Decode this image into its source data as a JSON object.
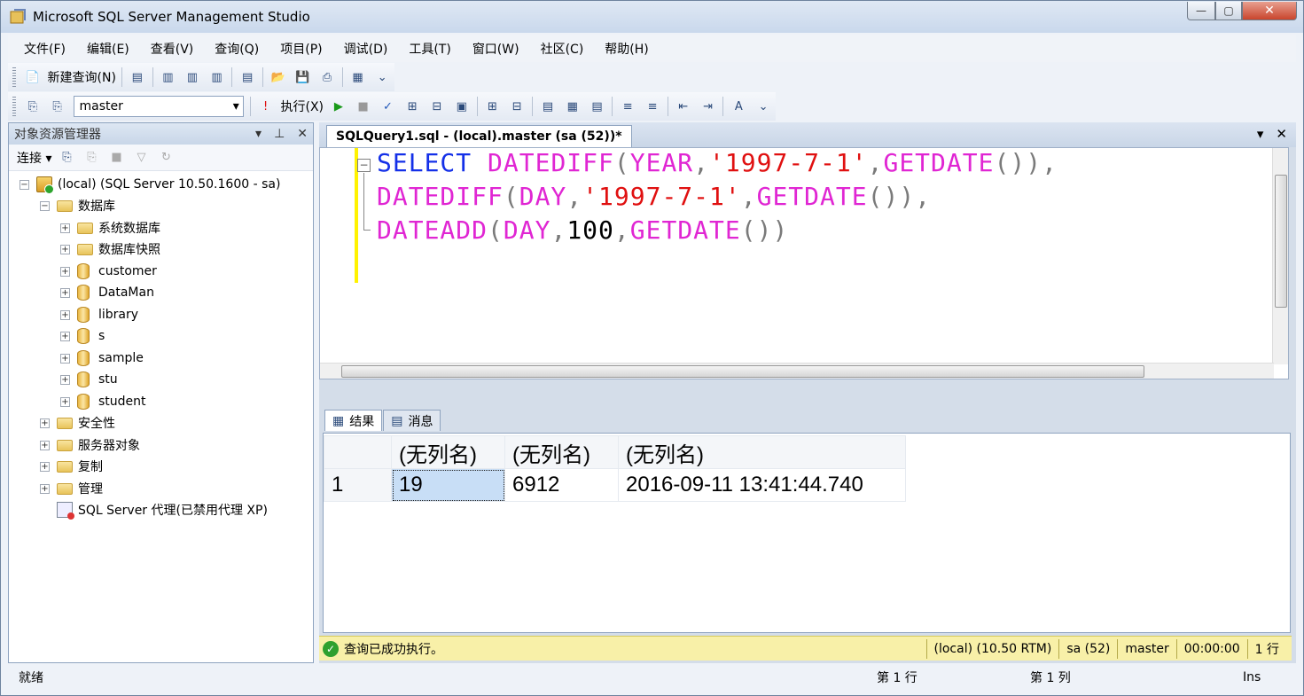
{
  "window": {
    "title": "Microsoft SQL Server Management Studio"
  },
  "menu": [
    "文件(F)",
    "编辑(E)",
    "查看(V)",
    "查询(Q)",
    "项目(P)",
    "调试(D)",
    "工具(T)",
    "窗口(W)",
    "社区(C)",
    "帮助(H)"
  ],
  "toolbar": {
    "new_query": "新建查询(N)",
    "database": "master",
    "execute": "执行(X)"
  },
  "object_explorer": {
    "title": "对象资源管理器",
    "connect": "连接",
    "server": "(local) (SQL Server 10.50.1600 - sa)",
    "databases_label": "数据库",
    "system_folders": [
      "系统数据库",
      "数据库快照"
    ],
    "databases": [
      "customer",
      "DataMan",
      "library",
      "s",
      "sample",
      "stu",
      "student"
    ],
    "server_folders": [
      "安全性",
      "服务器对象",
      "复制",
      "管理"
    ],
    "agent": "SQL Server 代理(已禁用代理 XP)"
  },
  "editor": {
    "tab": "SQLQuery1.sql - (local).master (sa (52))*",
    "lines": [
      "SELECT DATEDIFF(YEAR,'1997-7-1',GETDATE()),",
      "DATEDIFF(DAY,'1997-7-1',GETDATE()),",
      "DATEADD(DAY,100,GETDATE())"
    ]
  },
  "results": {
    "tabs": [
      "结果",
      "消息"
    ],
    "columns": [
      "(无列名)",
      "(无列名)",
      "(无列名)"
    ],
    "rows": [
      {
        "num": "1",
        "cells": [
          "19",
          "6912",
          "2016-09-11 13:41:44.740"
        ]
      }
    ]
  },
  "query_status": {
    "message": "查询已成功执行。",
    "server": "(local) (10.50 RTM)",
    "user": "sa (52)",
    "db": "master",
    "time": "00:00:00",
    "rows": "1 行"
  },
  "statusbar": {
    "ready": "就绪",
    "line": "第 1 行",
    "col": "第 1 列",
    "mode": "Ins"
  }
}
